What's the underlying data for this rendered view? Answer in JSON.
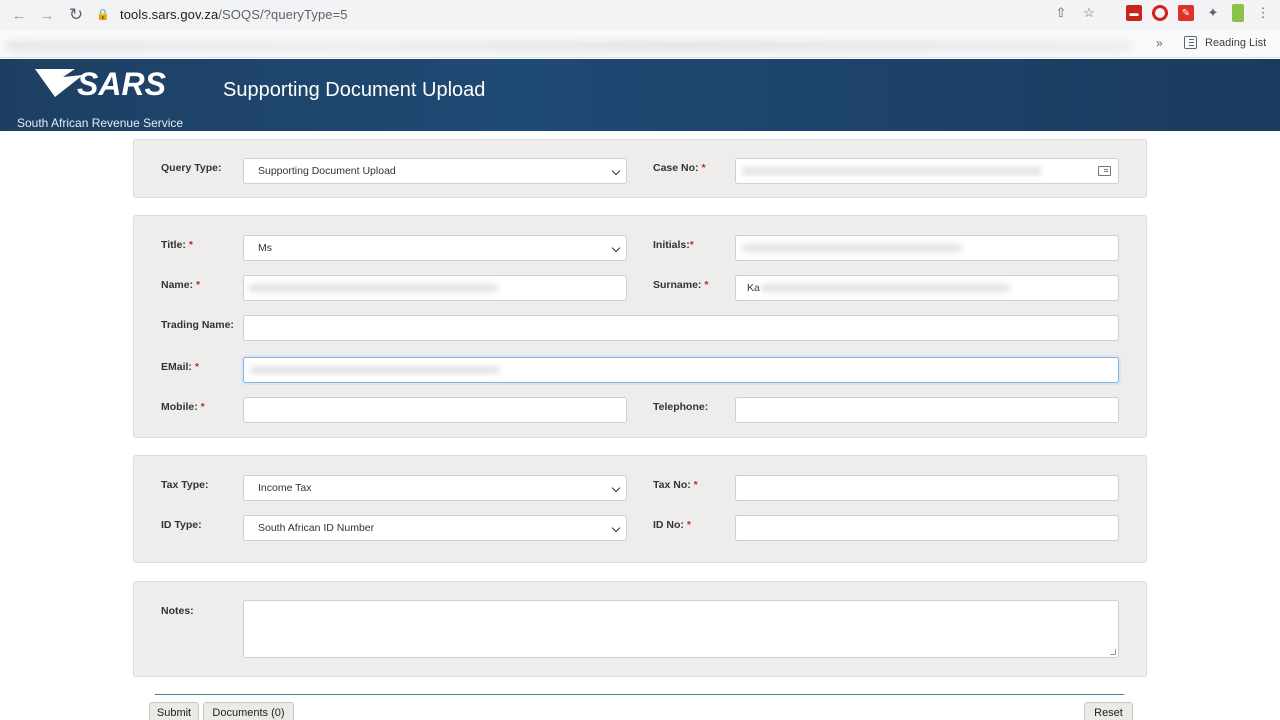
{
  "browser": {
    "url_host": "tools.sars.gov.za",
    "url_path": "/SOQS/?queryType=5",
    "reading_list_label": "Reading List",
    "more_label": "»"
  },
  "banner": {
    "logo_text": "SARS",
    "org_name": "South African Revenue Service",
    "title": "Supporting Document Upload",
    "bg_color": "#1f4a74"
  },
  "query": {
    "query_type_label": "Query Type:",
    "query_type_value": "Supporting Document Upload",
    "case_no_label": "Case No:"
  },
  "person": {
    "title_label": "Title:",
    "title_value": "Ms",
    "initials_label": "Initials:",
    "name_label": "Name:",
    "surname_label": "Surname:",
    "surname_value": "Ka",
    "trading_name_label": "Trading Name:",
    "email_label": "EMail:",
    "mobile_label": "Mobile:",
    "telephone_label": "Telephone:"
  },
  "tax": {
    "tax_type_label": "Tax Type:",
    "tax_type_value": "Income Tax",
    "tax_no_label": "Tax No:",
    "id_type_label": "ID Type:",
    "id_type_value": "South African ID Number",
    "id_no_label": "ID No:"
  },
  "notes": {
    "label": "Notes:"
  },
  "actions": {
    "submit": "Submit",
    "documents": "Documents (0)",
    "reset": "Reset"
  },
  "required_marker": "*",
  "required_color": "#c62828"
}
